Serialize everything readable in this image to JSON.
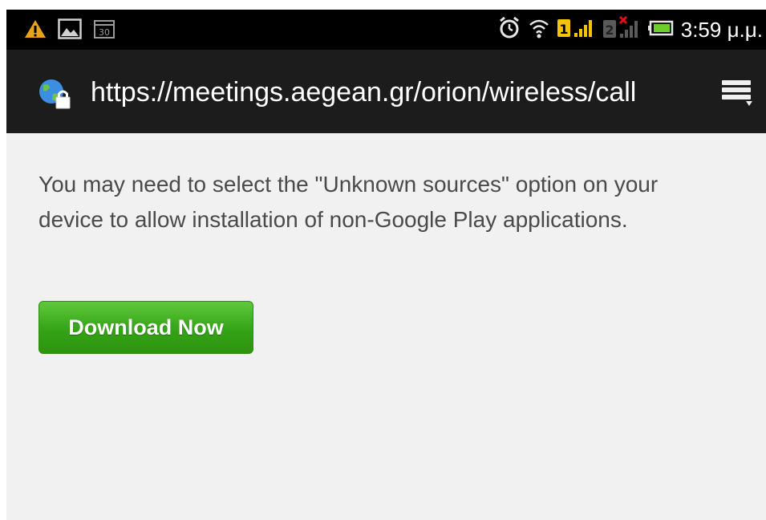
{
  "status_bar": {
    "time": "3:59 μ.μ.",
    "left_icons": [
      "warning-icon",
      "gallery-icon",
      "calendar-icon"
    ],
    "right_icons": [
      "alarm-icon",
      "wifi-icon",
      "sim1-signal-icon",
      "sim2-no-signal-icon",
      "battery-icon"
    ],
    "sim1_label": "1",
    "sim2_label": "2",
    "calendar_label": "30"
  },
  "browser": {
    "url": "https://meetings.aegean.gr/orion/wireless/call",
    "globe_icon": "secure-globe-icon",
    "menu_icon": "menu-icon"
  },
  "page": {
    "message": "You may need to select the \"Unknown sources\" option on your device to allow installation of non-Google Play applications.",
    "download_button": "Download Now"
  },
  "colors": {
    "status_bg": "#000000",
    "url_bg": "#1c1c1c",
    "page_bg": "#f1f1f1",
    "button_green": "#34a315",
    "text": "#4a4a4a",
    "warning": "#e8a317",
    "sim_yellow": "#f5c400",
    "sim_red": "#e01010"
  }
}
